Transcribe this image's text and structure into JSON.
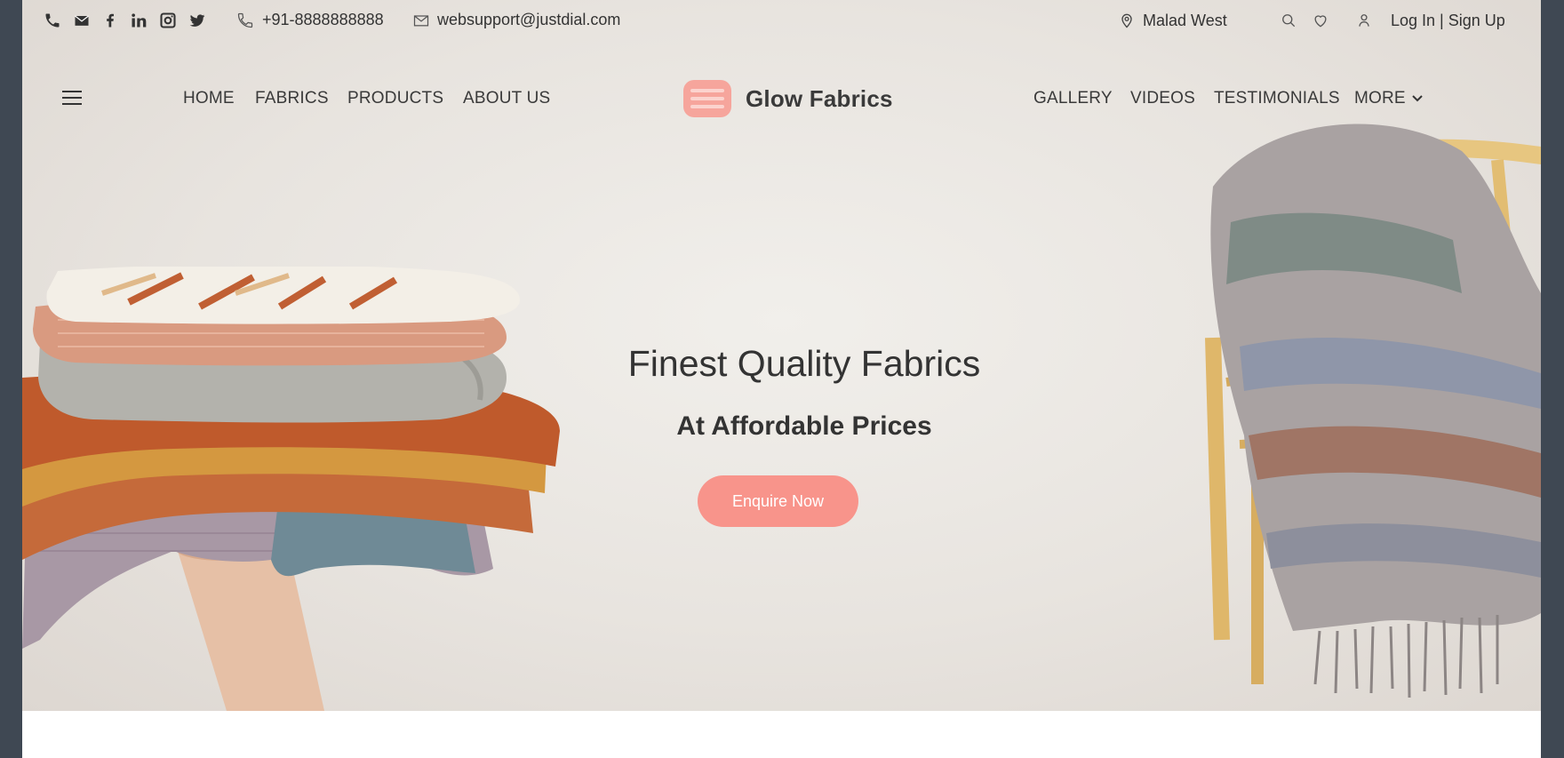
{
  "topbar": {
    "social_icons": [
      "phone-icon",
      "mail-icon",
      "facebook-icon",
      "linkedin-icon",
      "instagram-icon",
      "twitter-icon"
    ],
    "phone": "+91-8888888888",
    "email": "websupport@justdial.com",
    "location": "Malad West",
    "auth": "Log In | Sign Up"
  },
  "nav": {
    "left": [
      "HOME",
      "FABRICS",
      "PRODUCTS",
      "ABOUT US"
    ],
    "right": [
      "GALLERY",
      "VIDEOS",
      "TESTIMONIALS",
      "MORE"
    ]
  },
  "brand": {
    "name": "Glow Fabrics",
    "accent": "#f8948b"
  },
  "hero": {
    "title": "Finest Quality Fabrics",
    "subtitle": "At Affordable Prices",
    "cta": "Enquire Now"
  },
  "colors": {
    "frame": "#3f4853",
    "hero_bg": "#e8e4df",
    "text": "#333333"
  }
}
